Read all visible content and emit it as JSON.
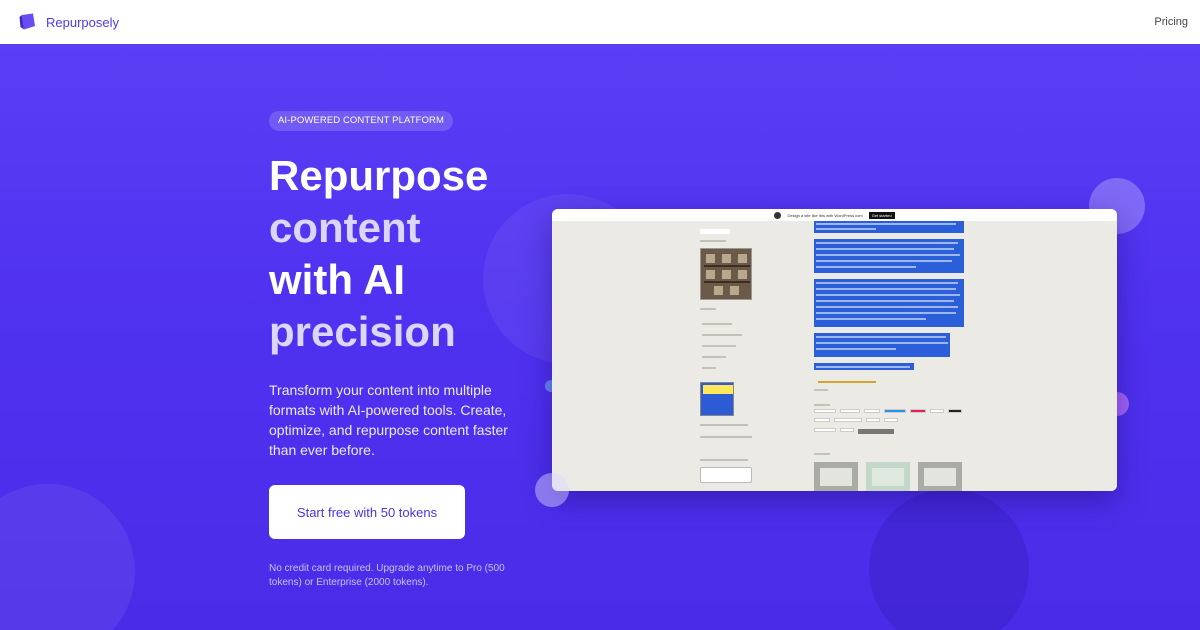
{
  "brand": {
    "name": "Repurposely",
    "logo_icon": "cube-logo-icon",
    "accent": "#4f3bf0"
  },
  "nav": {
    "pricing_label": "Pricing"
  },
  "hero": {
    "badge": "AI-POWERED CONTENT PLATFORM",
    "headline": [
      "Repurpose",
      "content",
      "with AI",
      "precision"
    ],
    "subtitle": "Transform your content into multiple formats with AI-powered tools. Create, optimize, and repurpose content faster than ever before.",
    "cta_label": "Start free with 50 tokens",
    "fineprint": "No credit card required. Upgrade anytime to Pro (500 tokens) or Enterprise (2000 tokens).",
    "background_color": "#5036f0"
  },
  "preview": {
    "top_bar_text": "Design a site like this with WordPress.com",
    "top_bar_button": "Get started",
    "wordpress_icon": "wordpress-logo-icon"
  }
}
